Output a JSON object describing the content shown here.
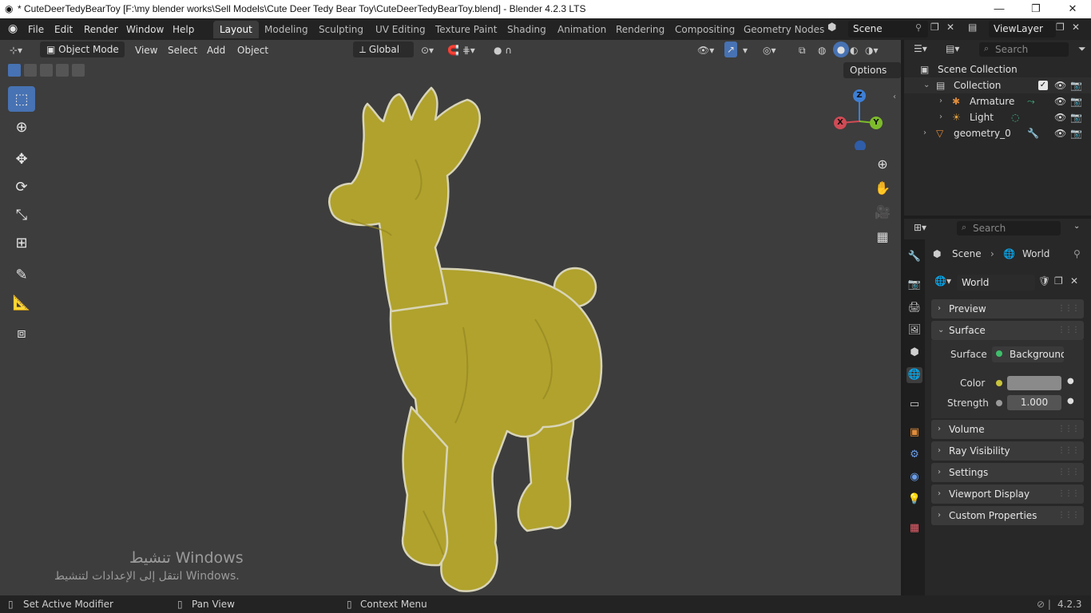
{
  "window": {
    "title": "* CuteDeerTedyBearToy [F:\\my blender works\\Sell Models\\Cute Deer Tedy Bear Toy\\CuteDeerTedyBearToy.blend] - Blender 4.2.3 LTS",
    "minimize": "—",
    "maximize": "❐",
    "close": "✕"
  },
  "menu": [
    "File",
    "Edit",
    "Render",
    "Window",
    "Help"
  ],
  "workspaces": [
    "Layout",
    "Modeling",
    "Sculpting",
    "UV Editing",
    "Texture Paint",
    "Shading",
    "Animation",
    "Rendering",
    "Compositing",
    "Geometry Nodes"
  ],
  "active_workspace": "Layout",
  "scene": {
    "name": "Scene"
  },
  "viewlayer": {
    "name": "ViewLayer"
  },
  "viewport_header": {
    "mode": "Object Mode",
    "menus": [
      "View",
      "Select",
      "Add",
      "Object"
    ],
    "orientation": "Global",
    "options": "Options"
  },
  "outliner": {
    "search_placeholder": "Search",
    "scene_collection": "Scene Collection",
    "items": [
      {
        "label": "Collection"
      },
      {
        "label": "Armature"
      },
      {
        "label": "Light"
      },
      {
        "label": "geometry_0"
      }
    ]
  },
  "properties": {
    "search_placeholder": "Search",
    "breadcrumb": [
      "Scene",
      "World"
    ],
    "world_name": "World",
    "panels": {
      "preview": "Preview",
      "surface": "Surface",
      "volume": "Volume",
      "ray_visibility": "Ray Visibility",
      "settings": "Settings",
      "viewport_display": "Viewport Display",
      "custom_properties": "Custom Properties"
    },
    "surface_label": "Surface",
    "surface_value": "Background",
    "color_label": "Color",
    "color_value": "#8a8a8a",
    "strength_label": "Strength",
    "strength_value": "1.000"
  },
  "gizmo": {
    "x": "X",
    "y": "Y",
    "z": "Z"
  },
  "watermark": {
    "line1": "تنشيط Windows",
    "line2": "انتقل إلى الإعدادات لتنشيط Windows."
  },
  "statusbar": {
    "left": "Set Active Modifier",
    "middle": "Pan View",
    "right": "Context Menu",
    "version": "4.2.3"
  },
  "colors": {
    "accent": "#4772b3",
    "model": "#b0a22c",
    "viewport_bg": "#3d3d3d"
  }
}
